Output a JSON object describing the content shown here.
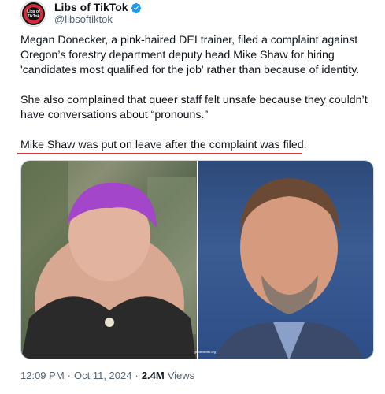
{
  "author": {
    "display_name": "Libs of TikTok",
    "handle": "@libsoftiktok",
    "avatar_text": "Libs of TikTok",
    "verified_color": "#1d9bf0"
  },
  "tweet": {
    "paragraph1": "Megan Donecker, a pink-haired DEI trainer, filed a complaint against Oregon’s forestry department deputy head Mike Shaw for hiring 'candidates most qualified for the job' rather than because of identity.",
    "paragraph2": "She also complained that queer staff felt unsafe because they couldn’t have conversations about “pronouns.”",
    "paragraph3": "Mike Shaw was put on leave after the complaint was filed.",
    "underline_color": "#d63a3a"
  },
  "media": {
    "credit": "gardenexits.org"
  },
  "meta": {
    "time": "12:09 PM",
    "date": "Oct 11, 2024",
    "views_count": "2.4M",
    "views_label": "Views",
    "separator": "·"
  }
}
